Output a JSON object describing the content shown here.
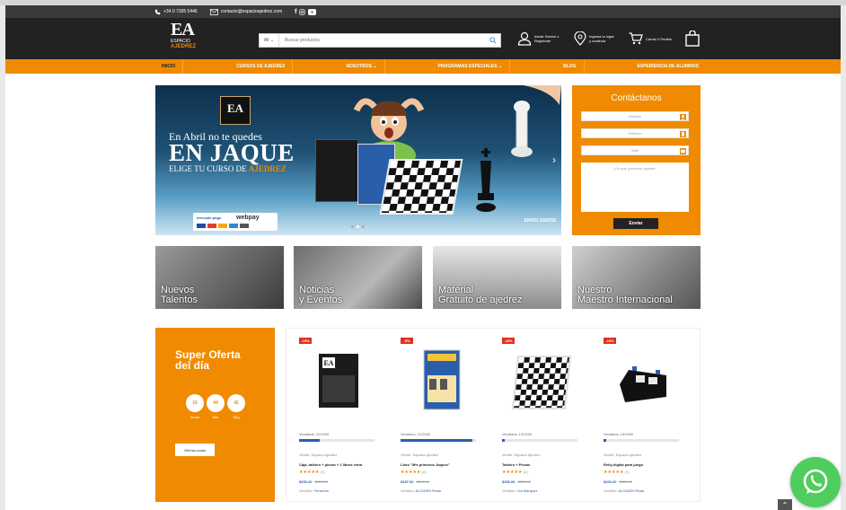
{
  "topbar": {
    "phone": "+34 0 7305 5446",
    "email": "contacto@espacioajedrez.com",
    "social": [
      "facebook-icon",
      "instagram-icon",
      "youtube-icon"
    ]
  },
  "header": {
    "logo_letters": "EA",
    "logo_line1": "ESPACIO",
    "logo_line2": "AJEDREZ",
    "search_category": "All",
    "search_placeholder": "Buscar productos",
    "links": [
      {
        "label": "Iniciar Sesión o Registrate",
        "icon": "user-icon"
      },
      {
        "label": "Ingresa tu lugar y continúa",
        "icon": "location-pin-icon"
      },
      {
        "label": "Carrito 0 Pedido",
        "icon": "cart-icon"
      }
    ]
  },
  "nav": {
    "items": [
      "INICIO",
      "CURSOS DE AJEDREZ",
      "NOSOTROS ⌄",
      "PROGRAMAS ESPECIALES ⌄",
      "BLOG",
      "EXPERIENCIA DE ALUMNOS"
    ]
  },
  "banner": {
    "badge": "EA",
    "line1": "En Abril no te quedes",
    "line2": "EN JAQUE",
    "line3_prefix": "ELIGE TU CURSO DE ",
    "line3_highlight": "AJEDREZ",
    "shipping": "ENVÍO GRATIS",
    "pay_webpay": "webpay",
    "pay_mercado": "mercado pago"
  },
  "contact": {
    "title": "Contáctanos",
    "name_placeholder": "Nombre",
    "phone_placeholder": "Teléfono",
    "email_placeholder": "Mail",
    "message_placeholder": "¿En qué podemos ayudar?",
    "send": "Enviar"
  },
  "tiles": [
    {
      "label": "Nuevos\nTalentos"
    },
    {
      "label": "Noticias\ny Eventos"
    },
    {
      "label": "Material\nGratuito de ajedrez"
    },
    {
      "label": "Nuestro\nMaestro Internacional"
    }
  ],
  "offer": {
    "title": "Super Oferta del día",
    "countdown": [
      {
        "value": "10",
        "unit": "Horas"
      },
      {
        "value": "44",
        "unit": "Min"
      },
      {
        "value": "42",
        "unit": "Seg"
      }
    ],
    "button": "Ofertas todas"
  },
  "products": [
    {
      "discount": "-15%",
      "sold": "Vendidos: 21/2000",
      "progress": 0.27,
      "seller": "Vende: Espacio Ajedrez",
      "name": "Caja, tablero + piezas + 2 libros extra",
      "stars": "★★★★★",
      "reviews": "(0)",
      "price": "$250.00",
      "old": "$300.00",
      "vendido_by": "Vendido: ",
      "vendido_name": "Ferrando"
    },
    {
      "discount": "-5%",
      "sold": "Vendidos: 21/2000",
      "progress": 0.95,
      "seller": "Vende: Espacio Ajedrez",
      "name": "Libro \"Mis primeros Jaques\"",
      "stars": "★★★★★",
      "reviews": "(0)",
      "price": "$297.00",
      "old": "$310.00",
      "vendido_by": "Vendido: ",
      "vendido_name": "ALGUIEN Rivas"
    },
    {
      "discount": "-10%",
      "sold": "Vendidos: 13/1000",
      "progress": 0.04,
      "seller": "Vende: Espacio Ajedrez",
      "name": "Tablero + Piezas",
      "stars": "★★★★★",
      "reviews": "(0)",
      "price": "$356.00",
      "old": "$360.00",
      "vendido_by": "Vendido: ",
      "vendido_name": "Vía Marquez"
    },
    {
      "discount": "-10%",
      "sold": "Vendidos: 15/1000",
      "progress": 0.03,
      "seller": "Vende: Espacio Ajedrez",
      "name": "Reloj digital para juego",
      "stars": "★★★★★",
      "reviews": "(0)",
      "price": "$200.00",
      "old": "$300.00",
      "vendido_by": "Vendido: ",
      "vendido_name": "ALGUIEN Rivas"
    }
  ],
  "colors": {
    "accent": "#f08a00",
    "dark": "#222222",
    "link": "#2b5eab",
    "whatsapp": "#4fce5d",
    "discount": "#e0301e"
  }
}
